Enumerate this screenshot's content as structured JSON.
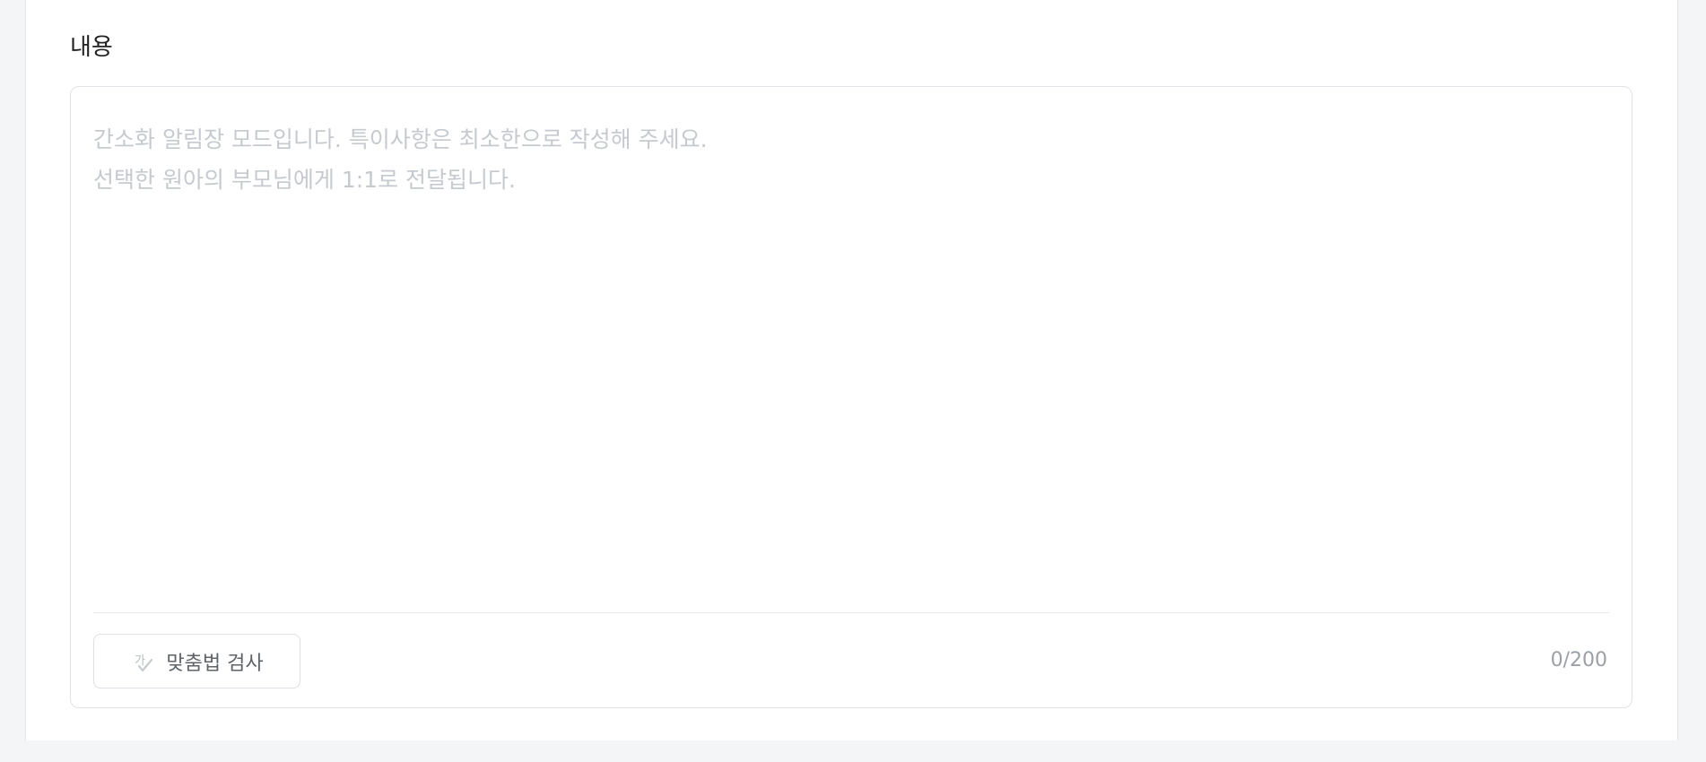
{
  "section": {
    "title": "내용"
  },
  "editor": {
    "placeholder_lines": [
      "간소화 알림장 모드입니다. 특이사항은 최소한으로 작성해 주세요.",
      "선택한 원아의 부모님에게 1:1로 전달됩니다."
    ],
    "spellcheck": {
      "label": "맞춤법 검사",
      "icon": "spellcheck-icon"
    },
    "counter": "0/200"
  }
}
